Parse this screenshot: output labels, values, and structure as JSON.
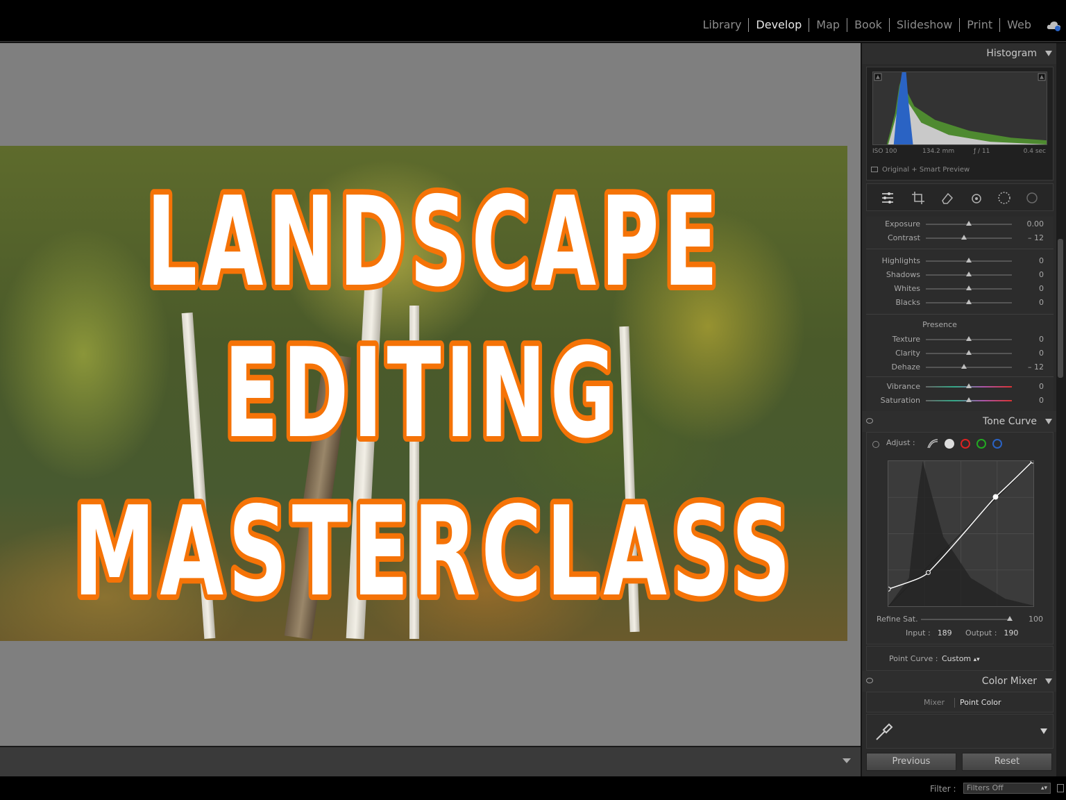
{
  "modules": [
    "Library",
    "Develop",
    "Map",
    "Book",
    "Slideshow",
    "Print",
    "Web"
  ],
  "active_module": "Develop",
  "photo": {
    "title_lines": [
      "LANDSCAPE",
      "EDITING",
      "MASTERCLASS"
    ]
  },
  "histogram": {
    "title": "Histogram",
    "iso": "ISO 100",
    "focal": "134.2 mm",
    "aperture": "ƒ / 11",
    "shutter": "0.4 sec",
    "preview": "Original + Smart Preview"
  },
  "basic": {
    "exposure": {
      "label": "Exposure",
      "value": "0.00",
      "pos": 0.5
    },
    "contrast": {
      "label": "Contrast",
      "value": "– 12",
      "pos": 0.44
    },
    "highlights": {
      "label": "Highlights",
      "value": "0",
      "pos": 0.5
    },
    "shadows": {
      "label": "Shadows",
      "value": "0",
      "pos": 0.5
    },
    "whites": {
      "label": "Whites",
      "value": "0",
      "pos": 0.5
    },
    "blacks": {
      "label": "Blacks",
      "value": "0",
      "pos": 0.5
    },
    "presence_label": "Presence",
    "texture": {
      "label": "Texture",
      "value": "0",
      "pos": 0.5
    },
    "clarity": {
      "label": "Clarity",
      "value": "0",
      "pos": 0.5
    },
    "dehaze": {
      "label": "Dehaze",
      "value": "– 12",
      "pos": 0.44
    },
    "vibrance": {
      "label": "Vibrance",
      "value": "0",
      "pos": 0.5
    },
    "saturation": {
      "label": "Saturation",
      "value": "0",
      "pos": 0.5
    }
  },
  "tone_curve": {
    "title": "Tone Curve",
    "adjust_label": "Adjust :",
    "refine_label": "Refine Sat.",
    "refine_value": "100",
    "input_label": "Input :",
    "input_value": "189",
    "output_label": "Output :",
    "output_value": "190",
    "point_curve_label": "Point Curve :",
    "point_curve_value": "Custom"
  },
  "color_mixer": {
    "title": "Color Mixer",
    "tabs": [
      "Mixer",
      "Point Color"
    ],
    "active_tab": "Point Color"
  },
  "buttons": {
    "previous": "Previous",
    "reset": "Reset"
  },
  "filter": {
    "label": "Filter :",
    "value": "Filters Off"
  },
  "colors": {
    "accent_orange": "#f57307",
    "blue_channel": "#2a63c4",
    "green_channel": "#5a8c3a"
  }
}
